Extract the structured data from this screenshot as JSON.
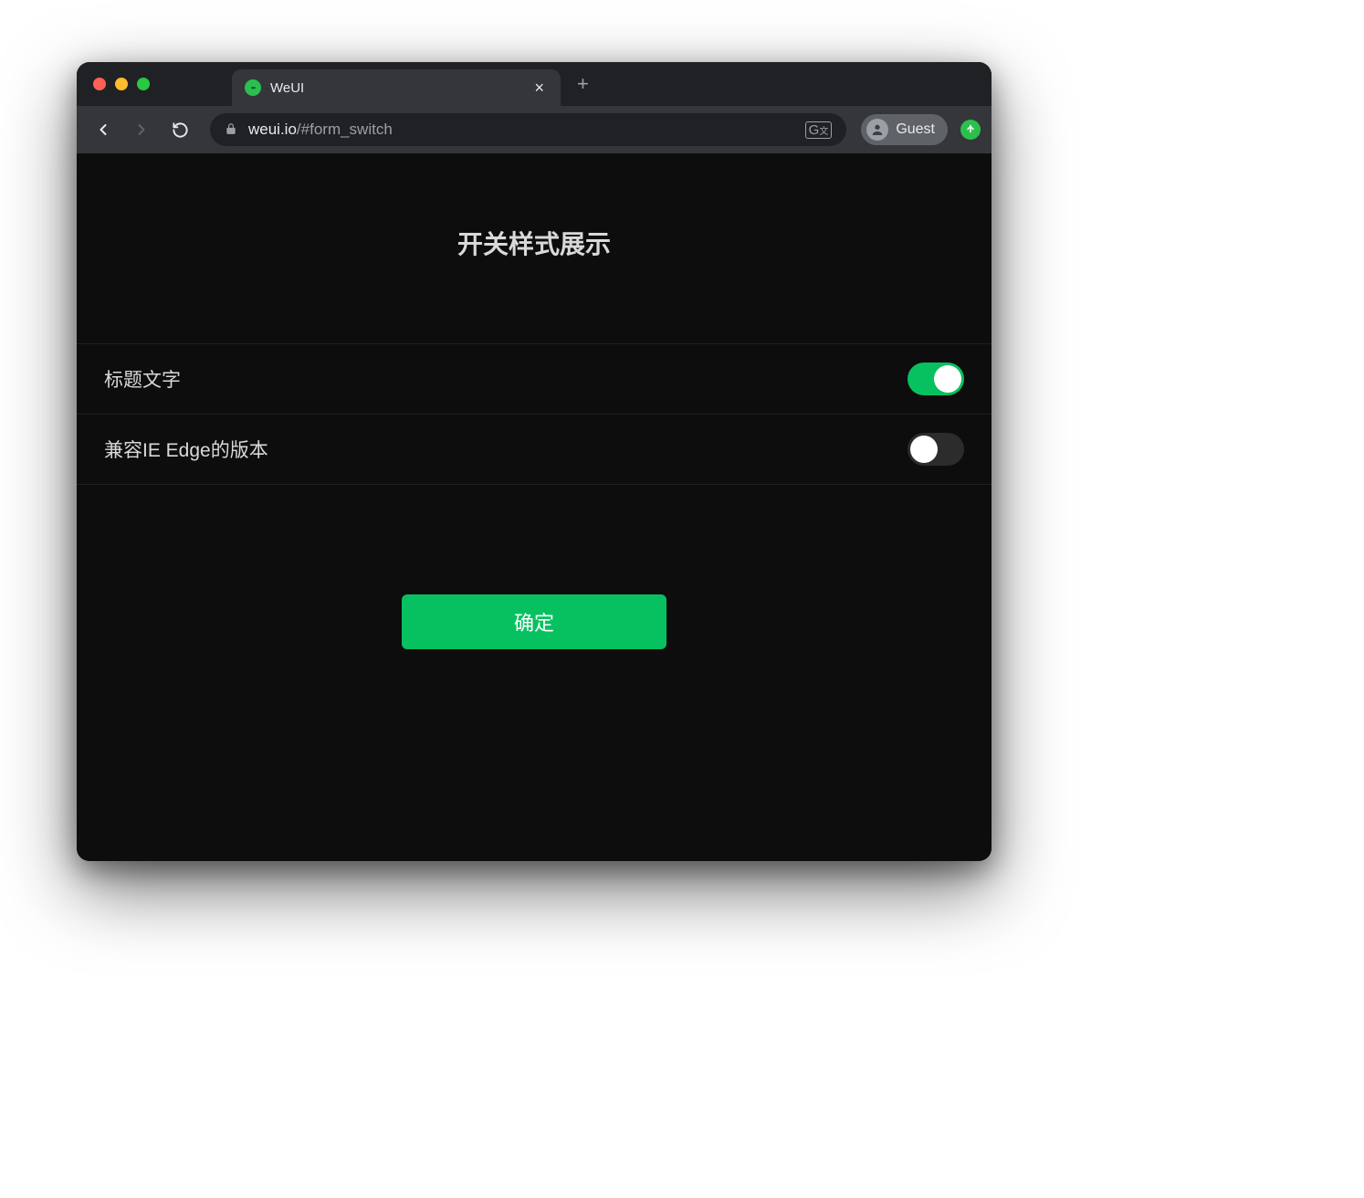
{
  "browser": {
    "tab_title": "WeUI",
    "url_host": "weui.io",
    "url_path": "/#form_switch",
    "profile_label": "Guest"
  },
  "page": {
    "title": "开关样式展示",
    "cells": [
      {
        "label": "标题文字",
        "on": true
      },
      {
        "label": "兼容IE Edge的版本",
        "on": false
      }
    ],
    "submit_label": "确定"
  },
  "colors": {
    "accent_green": "#07c160",
    "bg_dark": "#0d0d0d"
  }
}
